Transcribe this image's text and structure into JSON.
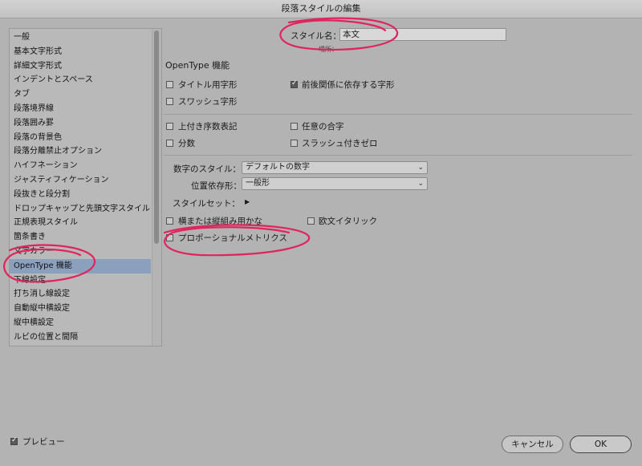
{
  "window": {
    "title": "段落スタイルの編集"
  },
  "sidebar": {
    "items": [
      {
        "label": "一般"
      },
      {
        "label": "基本文字形式"
      },
      {
        "label": "詳細文字形式"
      },
      {
        "label": "インデントとスペース"
      },
      {
        "label": "タブ"
      },
      {
        "label": "段落境界線"
      },
      {
        "label": "段落囲み罫"
      },
      {
        "label": "段落の背景色"
      },
      {
        "label": "段落分離禁止オプション"
      },
      {
        "label": "ハイフネーション"
      },
      {
        "label": "ジャスティフィケーション"
      },
      {
        "label": "段抜きと段分割"
      },
      {
        "label": "ドロップキャップと先頭文字スタイル"
      },
      {
        "label": "正規表現スタイル"
      },
      {
        "label": "箇条書き"
      },
      {
        "label": "文字カラー"
      },
      {
        "label": "OpenType 機能"
      },
      {
        "label": "下線設定"
      },
      {
        "label": "打ち消し線設定"
      },
      {
        "label": "自動縦中横設定"
      },
      {
        "label": "縦中横設定"
      },
      {
        "label": "ルビの位置と間隔"
      }
    ],
    "selected_index": 16
  },
  "style_name": {
    "label": "スタイル名：",
    "value": "本文",
    "location_label": "場所："
  },
  "section_title": "OpenType 機能",
  "options": {
    "titling": {
      "label": "タイトル用字形",
      "checked": false
    },
    "contextual": {
      "label": "前後関係に依存する字形",
      "checked": true
    },
    "swash": {
      "label": "スワッシュ字形",
      "checked": false
    },
    "ordinal": {
      "label": "上付き序数表記",
      "checked": false
    },
    "ligature": {
      "label": "任意の合字",
      "checked": false
    },
    "fractions": {
      "label": "分数",
      "checked": false
    },
    "slashed_zero": {
      "label": "スラッシュ付きゼロ",
      "checked": false
    },
    "vertical_kana": {
      "label": "横または縦組み用かな",
      "checked": false
    },
    "roman_italics": {
      "label": "欧文イタリック",
      "checked": false
    },
    "proportional_metrics": {
      "label": "プロポーショナルメトリクス",
      "checked": false
    }
  },
  "figure_style": {
    "label": "数字のスタイル：",
    "value": "デフォルトの数字"
  },
  "positional_form": {
    "label": "位置依存形：",
    "value": "一般形"
  },
  "stylistic_sets": {
    "label": "スタイルセット："
  },
  "preview": {
    "label": "プレビュー",
    "checked": true
  },
  "buttons": {
    "cancel": "キャンセル",
    "ok": "OK"
  },
  "colors": {
    "annotation": "#e0245e",
    "selection": "#8ba0bd"
  }
}
